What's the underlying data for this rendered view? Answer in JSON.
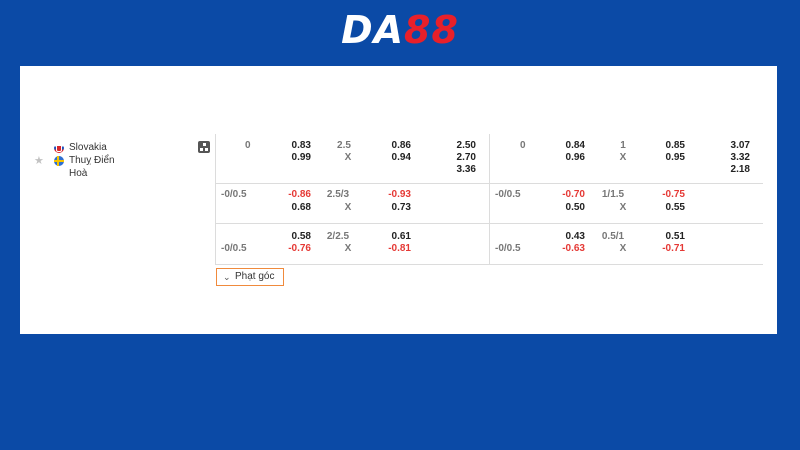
{
  "brand": {
    "logo_part1": "DA",
    "logo_part2": "88"
  },
  "match": {
    "teams": [
      {
        "name": "Slovakia",
        "flag_icon": "slovakia-flag-icon"
      },
      {
        "name": "Thuỵ Điển",
        "flag_icon": "sweden-flag-icon"
      }
    ],
    "draw_label": "Hoà"
  },
  "full_time": {
    "rows": [
      {
        "hdp": "0",
        "hdp_home": "0.83",
        "hdp_away": "0.99",
        "ou_line": "2.5",
        "ou_x": "X",
        "ou_over": "0.86",
        "ou_under": "0.94",
        "x12_1": "2.50",
        "x12_2": "2.70",
        "x12_x": "3.36"
      },
      {
        "hdp": "-0/0.5",
        "hdp_home": "-0.86",
        "hdp_away": "0.68",
        "ou_line": "2.5/3",
        "ou_x": "X",
        "ou_over": "-0.93",
        "ou_under": "0.73"
      },
      {
        "hdp": "-0/0.5",
        "hdp_home": "0.58",
        "hdp_away": "-0.76",
        "ou_line": "2/2.5",
        "ou_x": "X",
        "ou_over": "0.61",
        "ou_under": "-0.81"
      }
    ]
  },
  "first_half": {
    "rows": [
      {
        "hdp": "0",
        "hdp_home": "0.84",
        "hdp_away": "0.96",
        "ou_line": "1",
        "ou_x": "X",
        "ou_over": "0.85",
        "ou_under": "0.95",
        "x12_1": "3.07",
        "x12_2": "3.32",
        "x12_x": "2.18"
      },
      {
        "hdp": "-0/0.5",
        "hdp_home": "-0.70",
        "hdp_away": "0.50",
        "ou_line": "1/1.5",
        "ou_x": "X",
        "ou_over": "-0.75",
        "ou_under": "0.55"
      },
      {
        "hdp": "-0/0.5",
        "hdp_home": "0.43",
        "hdp_away": "-0.63",
        "ou_line": "0.5/1",
        "ou_x": "X",
        "ou_over": "0.51",
        "ou_under": "-0.71"
      }
    ]
  },
  "corners_button": {
    "label": "Phạt góc"
  },
  "colors": {
    "background": "#0b4aa6",
    "negative": "#e53935",
    "accent": "#f08a3c",
    "brand_red": "#e8202a"
  }
}
